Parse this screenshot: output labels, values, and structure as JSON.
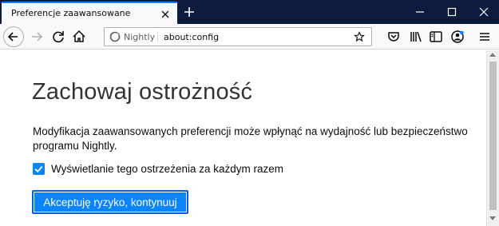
{
  "tab": {
    "title": "Preferencje zaawansowane"
  },
  "urlbar": {
    "identity_label": "Nightly",
    "url": "about:config"
  },
  "content": {
    "heading": "Zachowaj ostrożność",
    "description": "Modyfikacja zaawansowanych preferencji może wpłynąć na wydajność lub bezpieczeństwo programu Nightly.",
    "checkbox_label": "Wyświetlanie tego ostrzeżenia za każdym razem",
    "checkbox_checked": true,
    "accept_button": "Akceptuję ryzyko, kontynuuj"
  },
  "icons": {
    "tab_close": "close-icon",
    "new_tab": "plus-icon",
    "minimize": "minimize-icon",
    "maximize": "maximize-icon",
    "close_window": "close-window-icon",
    "back": "back-arrow-icon",
    "forward": "forward-arrow-icon",
    "reload": "reload-icon",
    "home": "home-icon",
    "identity": "nightly-logo-icon",
    "bookmark": "star-icon",
    "pocket": "pocket-icon",
    "library": "library-icon",
    "sidebar": "sidebar-icon",
    "account": "account-icon",
    "menu": "hamburger-menu-icon"
  },
  "colors": {
    "accent": "#0a84ff",
    "titlebar": "#0c1a3e",
    "toolbar": "#f9f9fb"
  }
}
